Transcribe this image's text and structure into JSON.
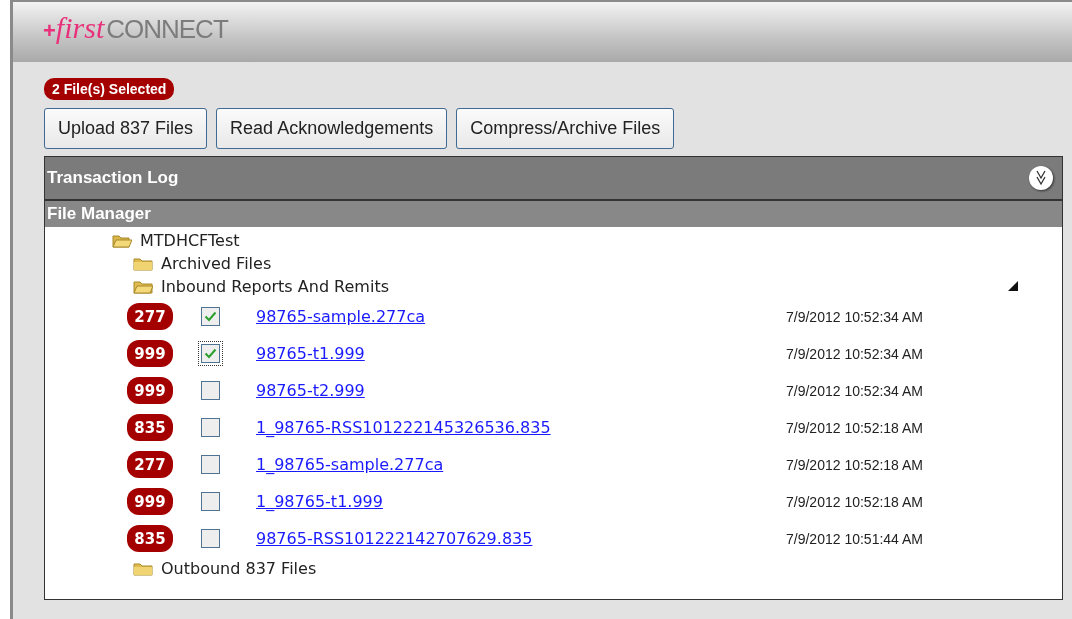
{
  "logo": {
    "mark": "+",
    "script": "first",
    "word": "CONNECT"
  },
  "selection_badge": "2 File(s) Selected",
  "buttons": [
    "Upload 837 Files",
    "Read Acknowledgements",
    "Compress/Archive Files"
  ],
  "transaction_log": {
    "title": "Transaction Log",
    "collapsed": true
  },
  "file_manager": {
    "title": "File Manager",
    "tree": [
      {
        "label": "MTDHCFTest",
        "expanded": true,
        "children": [
          {
            "label": "Archived Files",
            "expanded": false
          },
          {
            "label": "Inbound Reports And Remits",
            "expanded": true,
            "files": [
              {
                "badge": "277",
                "checked": true,
                "focused": false,
                "name": "98765-sample.277ca",
                "date": "7/9/2012 10:52:34 AM"
              },
              {
                "badge": "999",
                "checked": true,
                "focused": true,
                "name": "98765-t1.999",
                "date": "7/9/2012 10:52:34 AM"
              },
              {
                "badge": "999",
                "checked": false,
                "focused": false,
                "name": "98765-t2.999",
                "date": "7/9/2012 10:52:34 AM"
              },
              {
                "badge": "835",
                "checked": false,
                "focused": false,
                "name": "1_98765-RSS101222145326536.835",
                "date": "7/9/2012 10:52:18 AM"
              },
              {
                "badge": "277",
                "checked": false,
                "focused": false,
                "name": "1_98765-sample.277ca",
                "date": "7/9/2012 10:52:18 AM"
              },
              {
                "badge": "999",
                "checked": false,
                "focused": false,
                "name": "1_98765-t1.999",
                "date": "7/9/2012 10:52:18 AM"
              },
              {
                "badge": "835",
                "checked": false,
                "focused": false,
                "name": "98765-RSS101222142707629.835",
                "date": "7/9/2012 10:51:44 AM"
              }
            ]
          },
          {
            "label": "Outbound 837 Files",
            "expanded": false
          }
        ]
      }
    ]
  }
}
